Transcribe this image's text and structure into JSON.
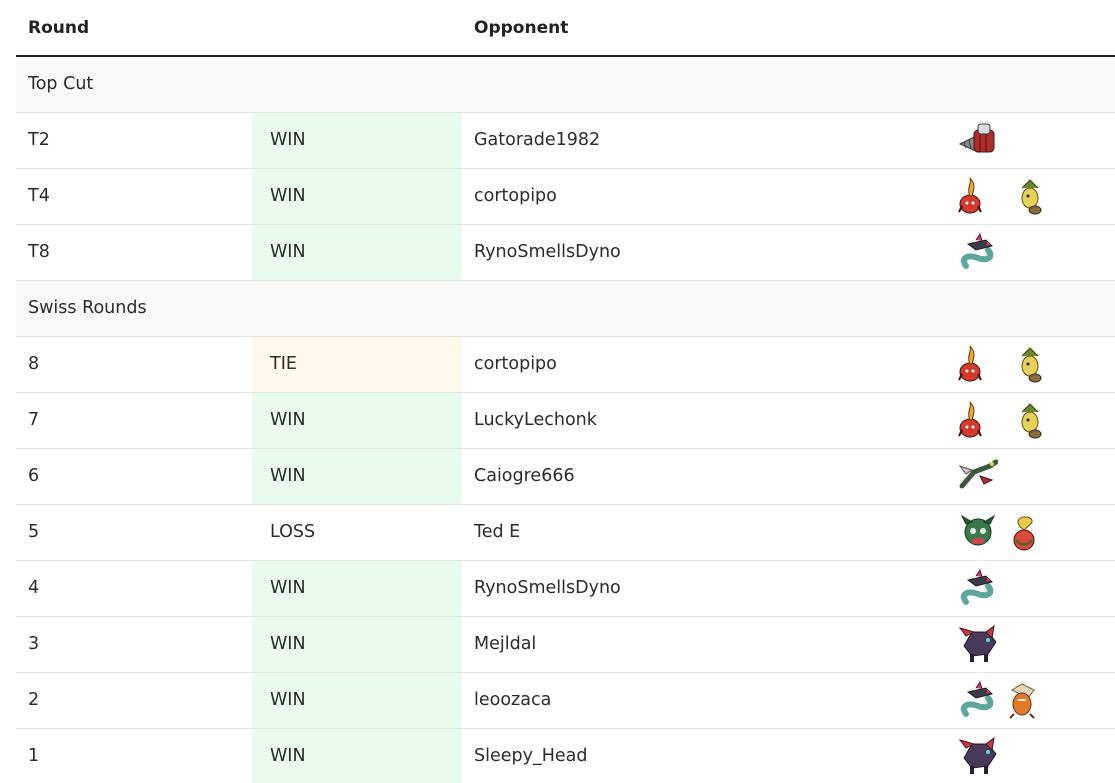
{
  "header": {
    "round_label": "Round",
    "opponent_label": "Opponent"
  },
  "colors": {
    "win_bg": "#e8fbee",
    "tie_bg": "#fff8ec",
    "section_bg": "#f8f8f8",
    "header_rule": "#222222"
  },
  "sections": [
    {
      "title": "Top Cut",
      "rows": [
        {
          "round": "T2",
          "result": "WIN",
          "opponent": "Gatorade1982",
          "team": [
            "drill-bug-sprite"
          ]
        },
        {
          "round": "T4",
          "result": "WIN",
          "opponent": "cortopipo",
          "team": [
            "flame-fruit-sprite",
            "yellow-leaf-sprite"
          ]
        },
        {
          "round": "T8",
          "result": "WIN",
          "opponent": "RynoSmellsDyno",
          "team": [
            "teal-serpent-sprite"
          ]
        }
      ]
    },
    {
      "title": "Swiss Rounds",
      "rows": [
        {
          "round": "8",
          "result": "TIE",
          "opponent": "cortopipo",
          "team": [
            "flame-fruit-sprite",
            "yellow-leaf-sprite"
          ]
        },
        {
          "round": "7",
          "result": "WIN",
          "opponent": "LuckyLechonk",
          "team": [
            "flame-fruit-sprite",
            "yellow-leaf-sprite"
          ]
        },
        {
          "round": "6",
          "result": "WIN",
          "opponent": "Caiogre666",
          "team": [
            "green-dragon-sprite"
          ]
        },
        {
          "round": "5",
          "result": "LOSS",
          "opponent": "Ted E",
          "team": [
            "green-mask-sprite",
            "apple-dragon-sprite"
          ]
        },
        {
          "round": "4",
          "result": "WIN",
          "opponent": "RynoSmellsDyno",
          "team": [
            "teal-serpent-sprite"
          ]
        },
        {
          "round": "3",
          "result": "WIN",
          "opponent": "Mejldal",
          "team": [
            "dark-fox-sprite"
          ]
        },
        {
          "round": "2",
          "result": "WIN",
          "opponent": "leoozaca",
          "team": [
            "teal-serpent-sprite",
            "orange-bird-sprite"
          ]
        },
        {
          "round": "1",
          "result": "WIN",
          "opponent": "Sleepy_Head",
          "team": [
            "dark-fox-sprite"
          ]
        }
      ]
    }
  ]
}
